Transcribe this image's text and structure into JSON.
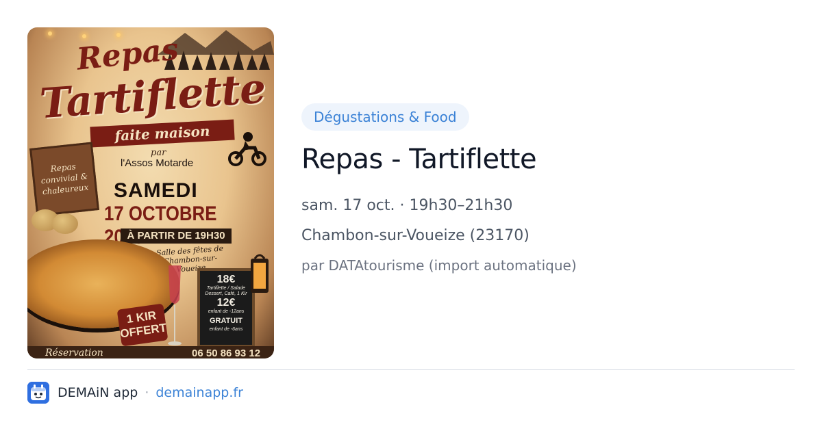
{
  "poster": {
    "line1": "Repas",
    "line2": "Tartiflette",
    "banner": "faite maison",
    "par": "par",
    "organizer": "l'Assos Motarde",
    "sign_text": "Repas convivial & chaleureux",
    "day": "SAMEDI",
    "date": "17 OCTOBRE 2026",
    "start": "À PARTIR DE 19H30",
    "venue": "Salle des fêtes de Chambon-sur-Voueize",
    "price1": "18€",
    "price1_detail": "Tartiflette / Salade Dessert, Café, 1 Kir",
    "price2": "12€",
    "price2_detail": "enfant de -12ans",
    "price3": "GRATUIT",
    "price3_detail": "enfant de -6ans",
    "kir": "1 KIR OFFERT",
    "reservation": "Réservation",
    "phone": "06 50 86 93 12"
  },
  "event": {
    "category": "Dégustations & Food",
    "title": "Repas - Tartiflette",
    "datetime": "sam. 17 oct. · 19h30–21h30",
    "location": "Chambon-sur-Voueize (23170)",
    "source": "par DATAtourisme (import automatique)"
  },
  "footer": {
    "app_name": "DEMAiN app",
    "separator": "·",
    "domain": "demainapp.fr"
  },
  "colors": {
    "accent": "#3b82d6",
    "tag_bg": "#eef4fc",
    "title": "#111827",
    "meta": "#4b5563"
  }
}
